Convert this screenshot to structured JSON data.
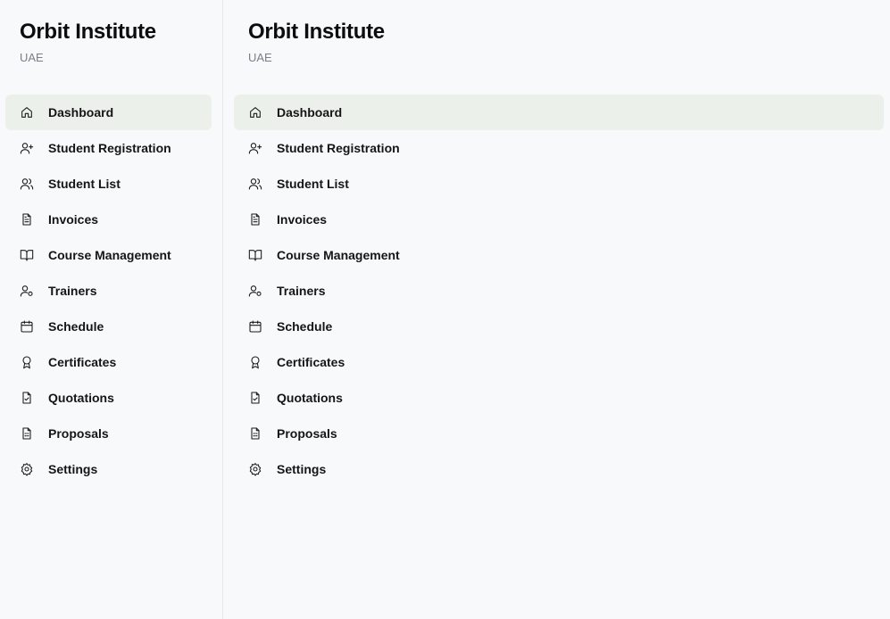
{
  "panels": [
    {
      "brand": {
        "title": "Orbit Institute",
        "subtitle": "UAE"
      },
      "active_index": 0
    },
    {
      "brand": {
        "title": "Orbit Institute",
        "subtitle": "UAE"
      },
      "active_index": 0
    }
  ],
  "nav": [
    {
      "label": "Dashboard",
      "icon": "home-icon"
    },
    {
      "label": "Student Registration",
      "icon": "user-plus-icon"
    },
    {
      "label": "Student List",
      "icon": "users-icon"
    },
    {
      "label": "Invoices",
      "icon": "file-text-icon"
    },
    {
      "label": "Course Management",
      "icon": "book-open-icon"
    },
    {
      "label": "Trainers",
      "icon": "user-cog-icon"
    },
    {
      "label": "Schedule",
      "icon": "calendar-icon"
    },
    {
      "label": "Certificates",
      "icon": "award-icon"
    },
    {
      "label": "Quotations",
      "icon": "file-check-icon"
    },
    {
      "label": "Proposals",
      "icon": "file-spreadsheet-icon"
    },
    {
      "label": "Settings",
      "icon": "gear-icon"
    }
  ],
  "colors": {
    "background": "#f8f9fb",
    "active_item": "#ebf1ea",
    "text": "#151515",
    "muted": "#7a7f87"
  }
}
